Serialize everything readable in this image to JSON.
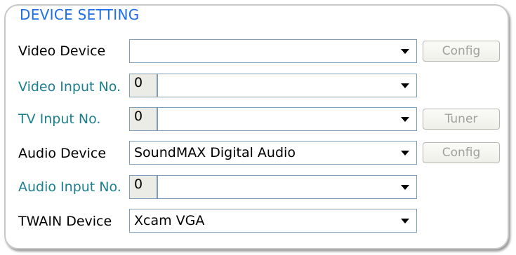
{
  "group": {
    "title": "DEVICE SETTING"
  },
  "rows": {
    "video_device": {
      "label": "Video Device",
      "value": "",
      "button": "Config"
    },
    "video_input": {
      "label": "Video Input No.",
      "number": "0",
      "value": ""
    },
    "tv_input": {
      "label": "TV Input No.",
      "number": "0",
      "value": "",
      "button": "Tuner"
    },
    "audio_device": {
      "label": "Audio Device",
      "value": "SoundMAX Digital Audio",
      "button": "Config"
    },
    "audio_input": {
      "label": "Audio Input No.",
      "number": "0",
      "value": ""
    },
    "twain_device": {
      "label": "TWAIN Device",
      "value": "Xcam VGA"
    }
  },
  "colors": {
    "title": "#1e6ee6",
    "teal_label": "#1b7f8c",
    "disabled_text": "#a0a0a0"
  },
  "icons": {
    "dropdown": "chevron-down-icon"
  }
}
